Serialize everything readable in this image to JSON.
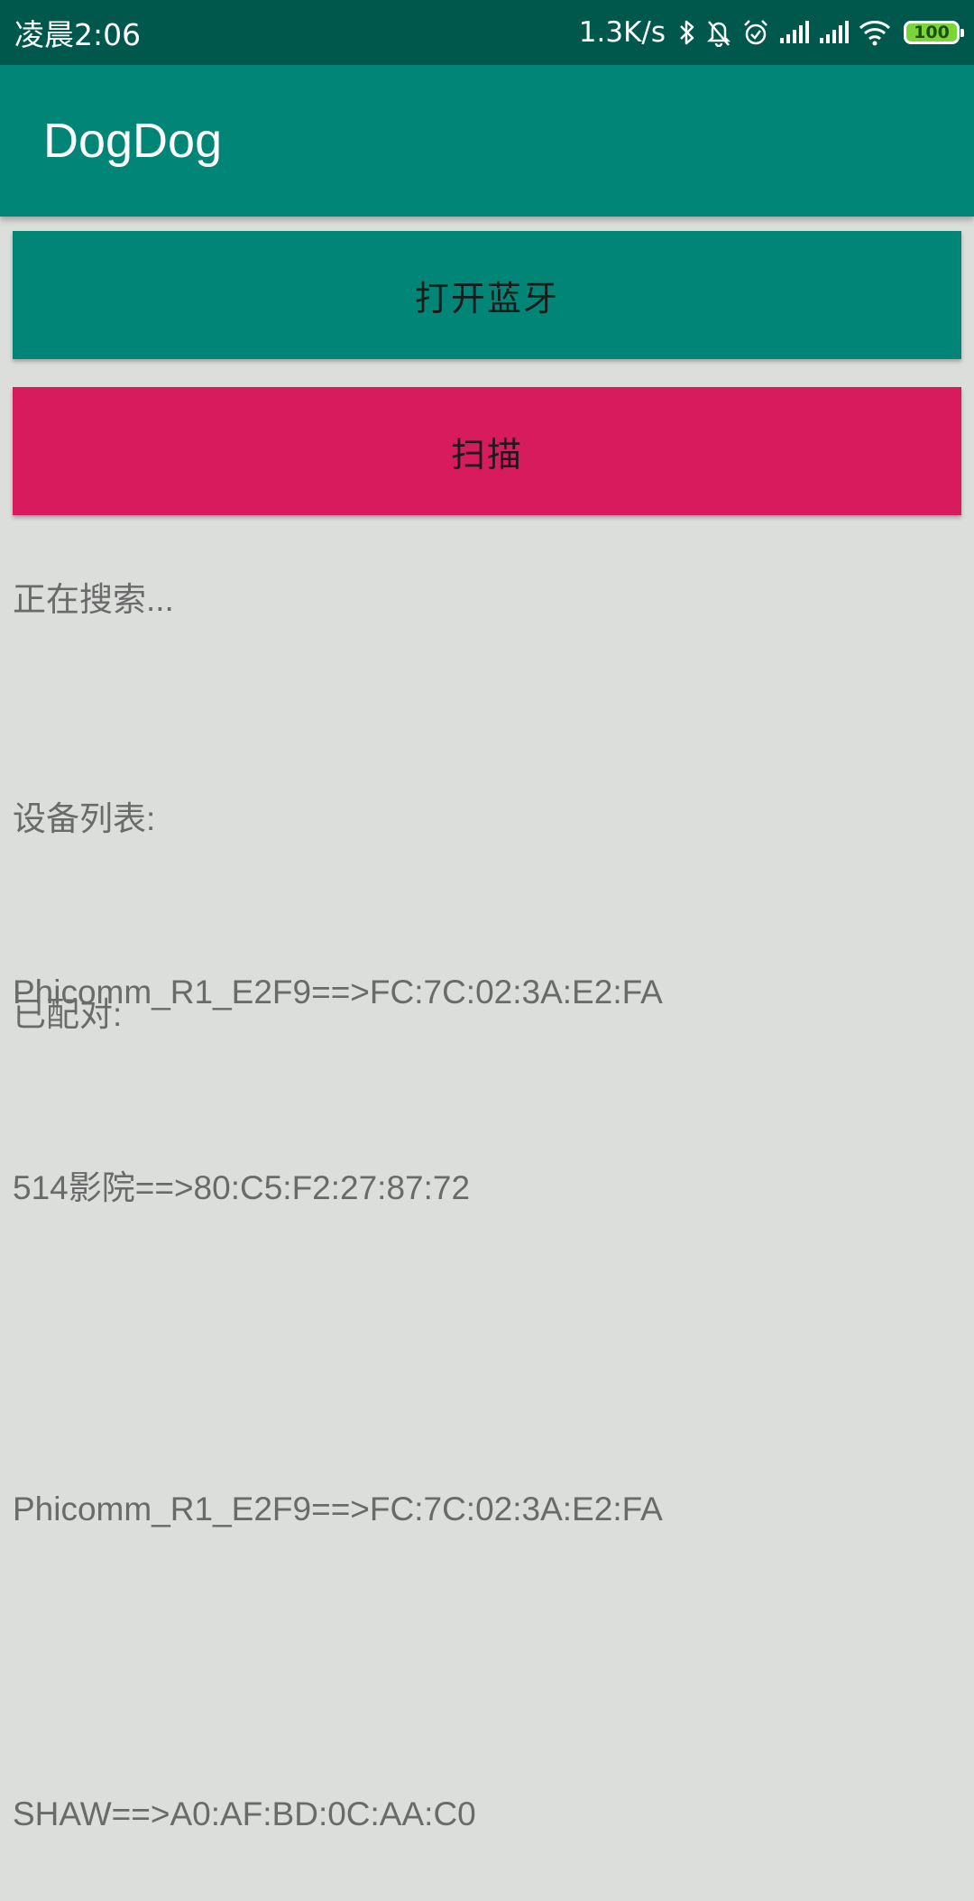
{
  "status_bar": {
    "time": "凌晨2:06",
    "speed": "1.3K/s",
    "battery": "100",
    "icons": [
      "bluetooth-icon",
      "mute-bell-icon",
      "alarm-icon",
      "signal-icon",
      "signal-icon",
      "wifi-icon",
      "battery-icon"
    ]
  },
  "app_bar": {
    "title": "DogDog",
    "color": "#008577"
  },
  "buttons": {
    "open_bluetooth": "打开蓝牙",
    "scan": "扫描",
    "open_bluetooth_color": "#008577",
    "scan_color": "#d81b5c"
  },
  "status_text": "正在搜索...",
  "device_list": {
    "header": "设备列表:",
    "items": [
      "Phicomm_R1_E2F9==>FC:7C:02:3A:E2:FA"
    ]
  },
  "paired": {
    "header": "已配对:",
    "items": [
      "514影院==>80:C5:F2:27:87:72",
      "Phicomm_R1_E2F9==>FC:7C:02:3A:E2:FA",
      "SHAW==>A0:AF:BD:0C:AA:C0"
    ]
  }
}
